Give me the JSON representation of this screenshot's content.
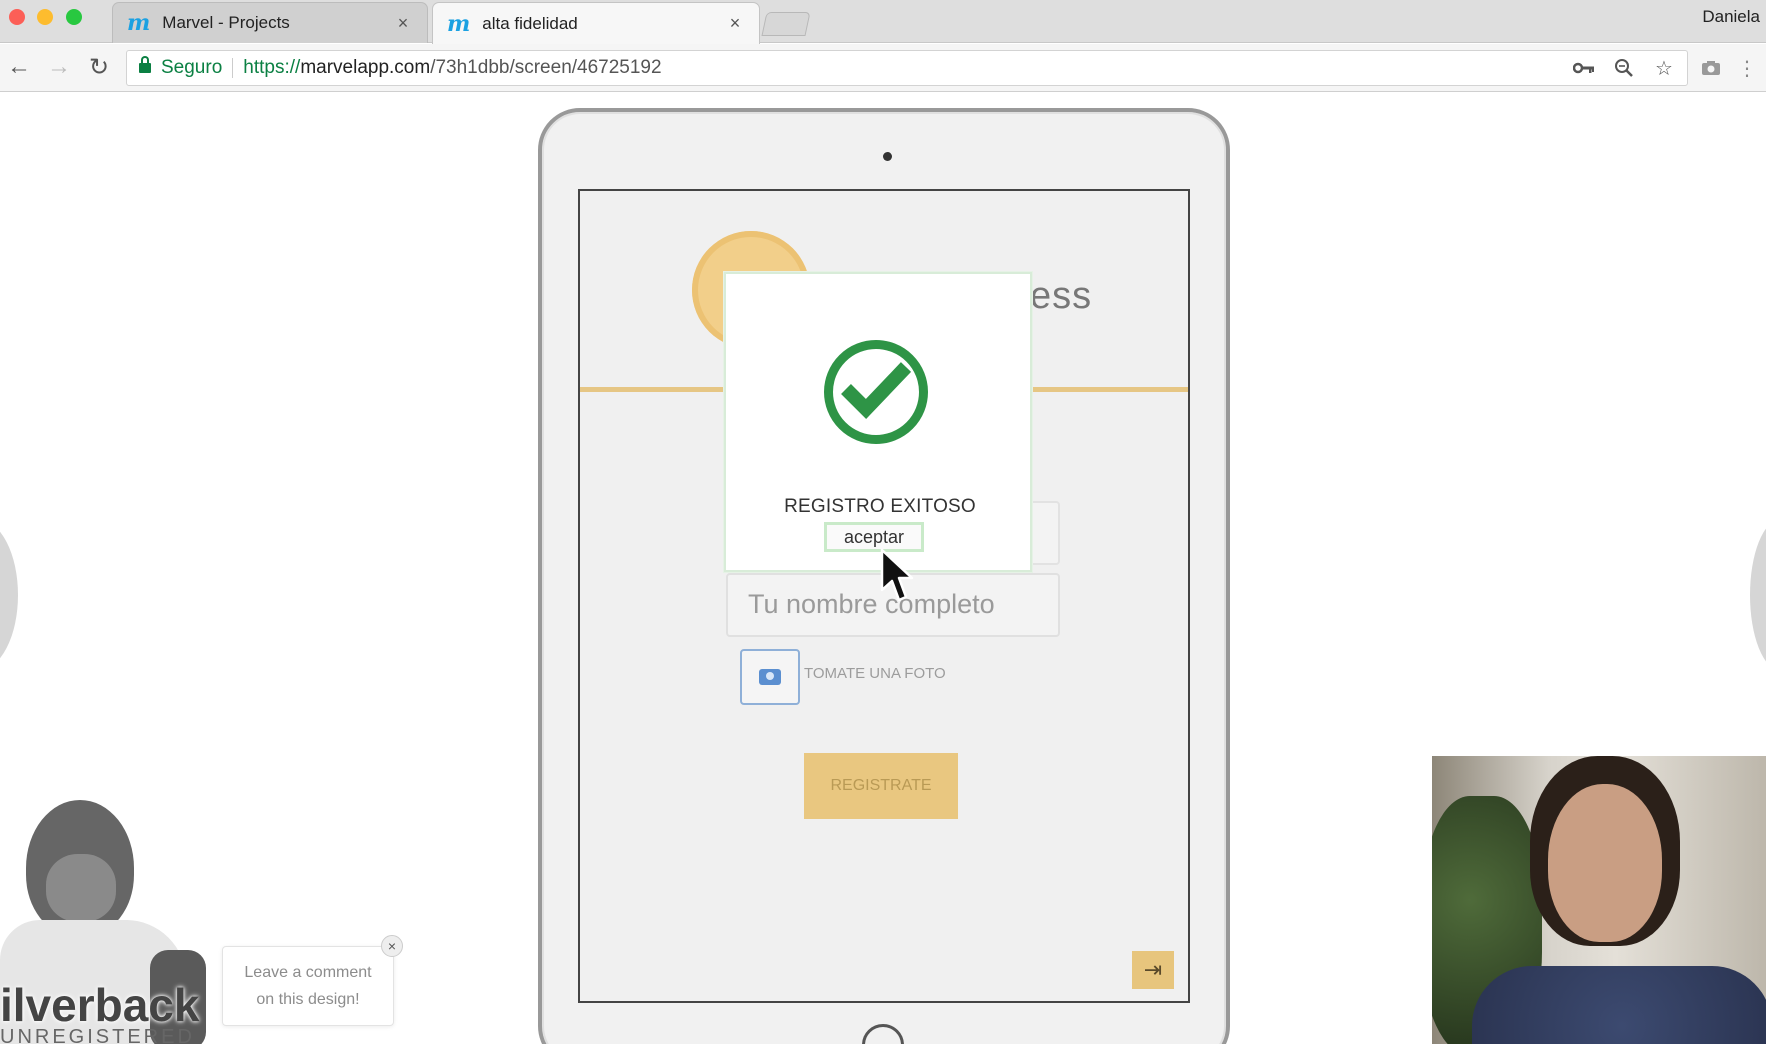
{
  "browser": {
    "tabs": [
      {
        "title": "Marvel - Projects",
        "logo": "m",
        "close": "×"
      },
      {
        "title": "alta fidelidad",
        "logo": "m",
        "close": "×"
      }
    ],
    "profile_name": "Daniela",
    "security_label": "Seguro",
    "url": {
      "protocol": "https://",
      "host": "marvelapp.com",
      "path": "/73h1dbb/screen/46725192"
    },
    "icons": [
      "back-icon",
      "forward-icon",
      "reload-icon",
      "lock-icon",
      "key-icon",
      "zoom-icon",
      "star-icon",
      "camera-extension-icon",
      "menu-icon"
    ]
  },
  "prototype": {
    "logo_partial_text": "ess",
    "name_placeholder": "Tu nombre completo",
    "photo_label": "TOMATE UNA FOTO",
    "register_label": "REGISTRATE",
    "exit_icon": "⇥",
    "modal": {
      "title": "REGISTRO EXITOSO",
      "accept_label": "aceptar",
      "icon": "check-circle-icon"
    }
  },
  "silverback": {
    "brand": "ilverback",
    "subtitle": "UNREGISTERED",
    "comment_line1": "Leave a comment",
    "comment_line2": "on this design!",
    "close": "×"
  },
  "colors": {
    "accent_gold": "#e9c780",
    "success_green": "#2e9446",
    "secure_green": "#0b8043",
    "marvel_blue": "#1ba1e2"
  }
}
